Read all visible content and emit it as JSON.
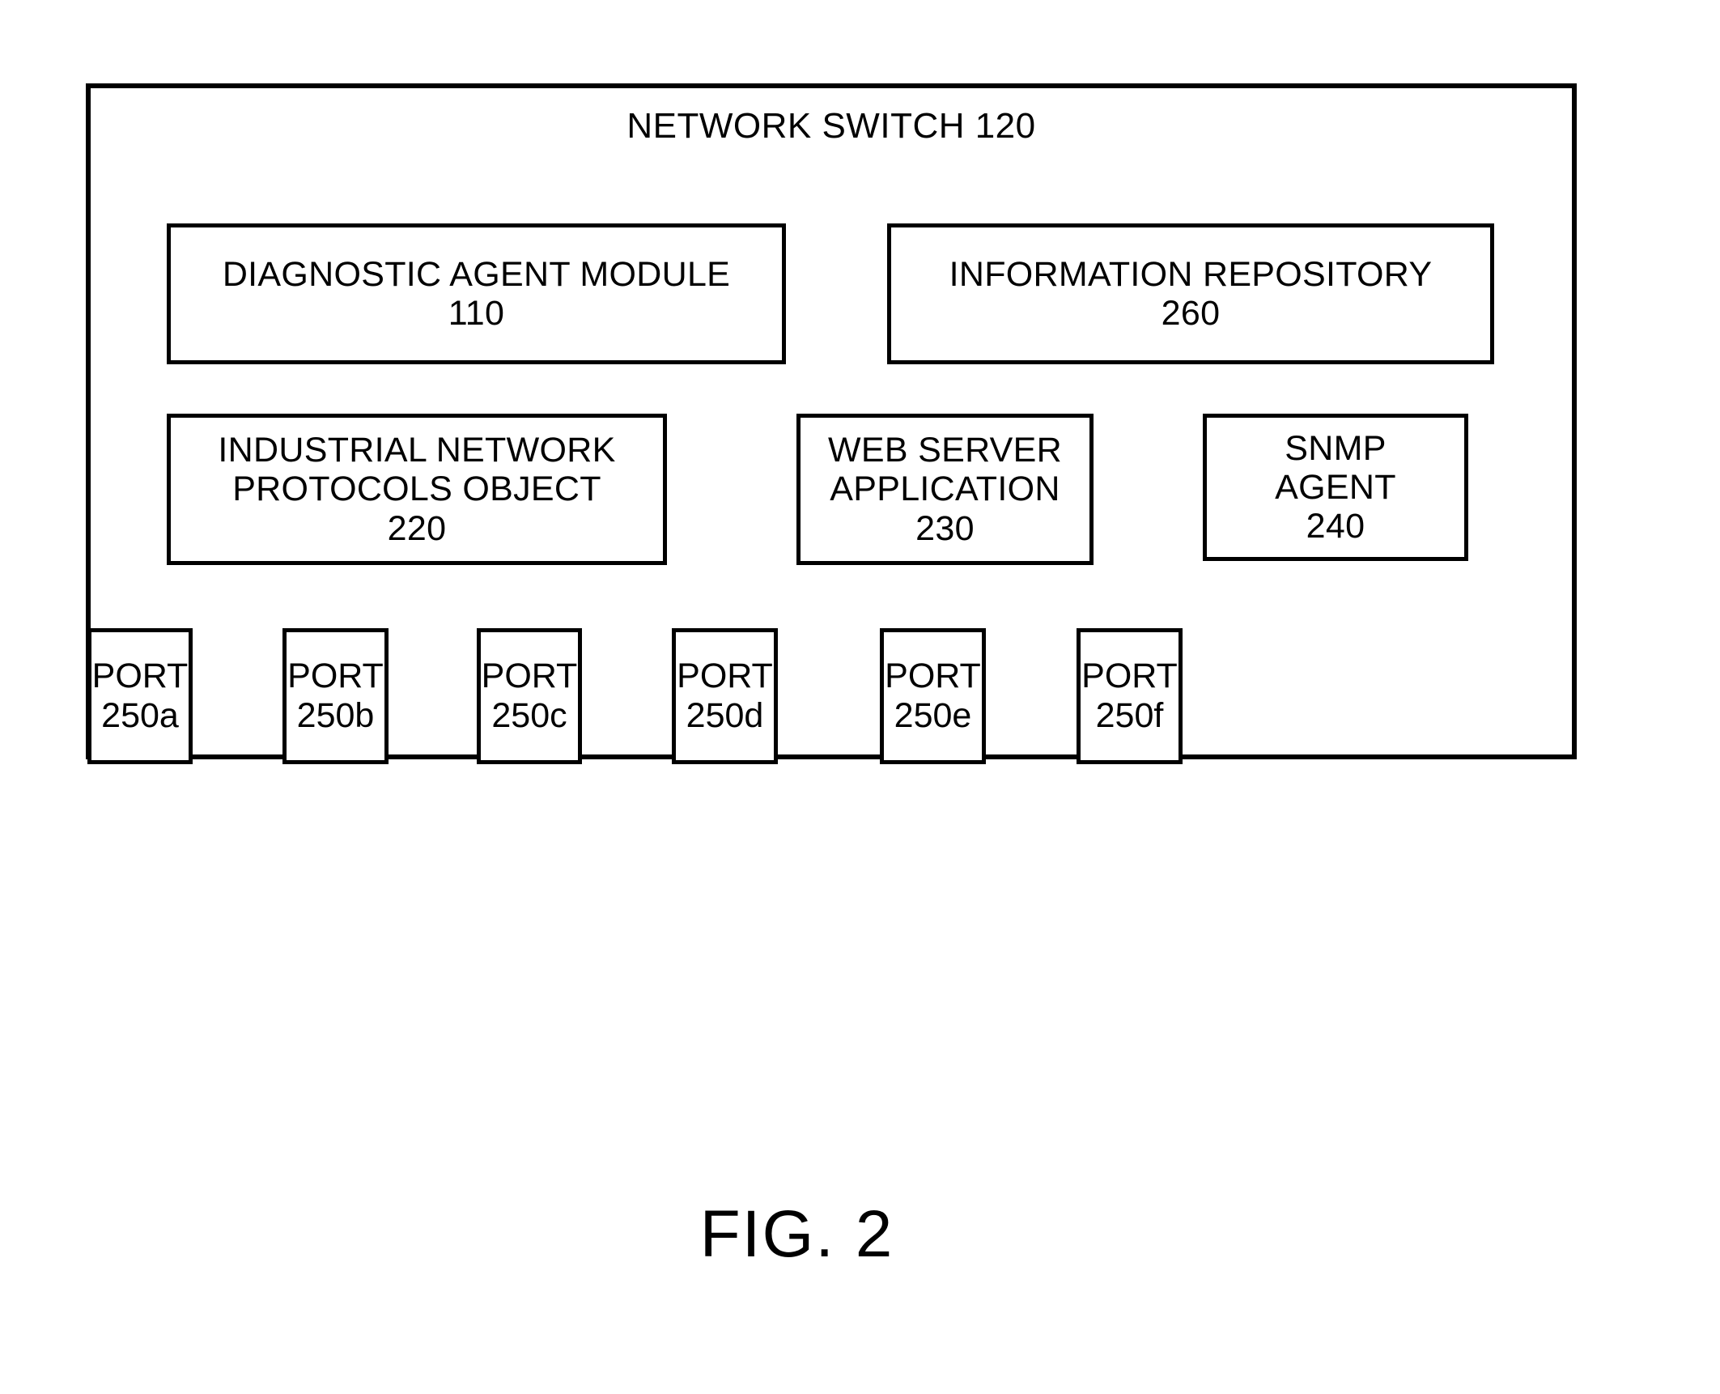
{
  "figure": {
    "caption": "FIG. 2"
  },
  "switch": {
    "title": "NETWORK SWITCH 120",
    "blocks": [
      {
        "id": "diagnostic-agent-module",
        "line1": "DIAGNOSTIC AGENT MODULE",
        "line2": "110"
      },
      {
        "id": "information-repository",
        "line1": "INFORMATION REPOSITORY",
        "line2": "260"
      },
      {
        "id": "industrial-network-protocols-object",
        "line1": "INDUSTRIAL NETWORK",
        "line2": "PROTOCOLS OBJECT",
        "line3": "220"
      },
      {
        "id": "web-server-application",
        "line1": "WEB SERVER",
        "line2": "APPLICATION",
        "line3": "230"
      },
      {
        "id": "snmp-agent",
        "line1": "SNMP",
        "line2": "AGENT",
        "line3": "240"
      }
    ],
    "ports": [
      {
        "label": "PORT",
        "ref": "250a"
      },
      {
        "label": "PORT",
        "ref": "250b"
      },
      {
        "label": "PORT",
        "ref": "250c"
      },
      {
        "label": "PORT",
        "ref": "250d"
      },
      {
        "label": "PORT",
        "ref": "250e"
      },
      {
        "label": "PORT",
        "ref": "250f"
      }
    ]
  },
  "colors": {
    "ink": "#000000",
    "paper": "#ffffff"
  }
}
